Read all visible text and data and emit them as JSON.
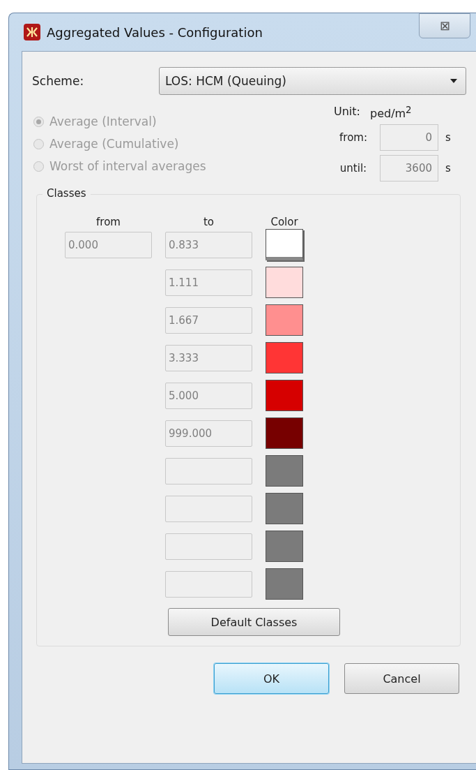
{
  "window": {
    "title": "Aggregated Values - Configuration",
    "close": "⊠"
  },
  "scheme": {
    "label": "Scheme:",
    "value": "LOS: HCM (Queuing)"
  },
  "modes": [
    {
      "label": "Average (Interval)",
      "selected": true,
      "disabled": true
    },
    {
      "label": "Average (Cumulative)",
      "selected": false,
      "disabled": true
    },
    {
      "label": "Worst of interval averages",
      "selected": false,
      "disabled": true
    }
  ],
  "unit": {
    "label": "Unit:",
    "value": "ped/m$^{2}$"
  },
  "time": [
    {
      "label": "from:",
      "value": "0",
      "suffix": "s"
    },
    {
      "label": "until:",
      "value": "3600",
      "suffix": "s"
    }
  ],
  "classes": {
    "title": "Classes",
    "headers": [
      "from",
      "to",
      "Color"
    ],
    "rows": [
      {
        "from": "0.000",
        "to": "0.833",
        "color": "#ffffff",
        "selected": true
      },
      {
        "to": "1.111",
        "color": "#ffdcdc",
        "selected": false
      },
      {
        "to": "1.667",
        "color": "#ff8f8f",
        "selected": false
      },
      {
        "to": "3.333",
        "color": "#ff3535",
        "selected": false
      },
      {
        "to": "5.000",
        "color": "#d60000",
        "selected": false
      },
      {
        "to": "999.000",
        "color": "#770000",
        "selected": false
      },
      {
        "to": "",
        "color": "#7b7b7b",
        "selected": false
      },
      {
        "to": "",
        "color": "#7b7b7b",
        "selected": false
      },
      {
        "to": "",
        "color": "#7b7b7b",
        "selected": false
      },
      {
        "to": "",
        "color": "#7b7b7b",
        "selected": false
      }
    ],
    "button": "Default Classes"
  },
  "buttons": [
    {
      "label": "OK",
      "default": true
    },
    {
      "label": "Cancel",
      "default": false
    }
  ]
}
